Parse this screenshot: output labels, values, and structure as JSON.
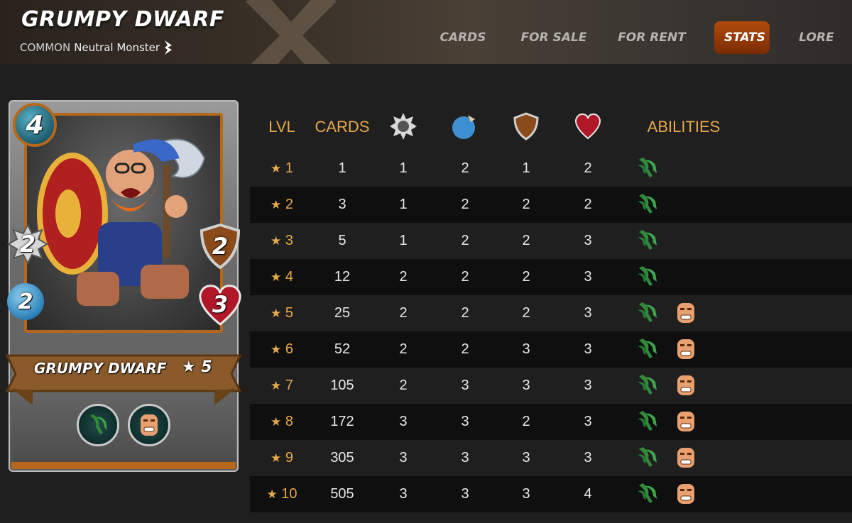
{
  "header": {
    "title": "GRUMPY DWARF",
    "rarity": "COMMON",
    "subtitle": "Neutral Monster",
    "tabs": [
      {
        "label": "CARDS",
        "active": false
      },
      {
        "label": "FOR SALE",
        "active": false
      },
      {
        "label": "FOR RENT",
        "active": false
      },
      {
        "label": "STATS",
        "active": true
      },
      {
        "label": "LORE",
        "active": false
      }
    ],
    "accent_color": "#b04a0a"
  },
  "card": {
    "name": "GRUMPY DWARF",
    "level": "★ 5",
    "mana": "4",
    "melee": "2",
    "speed": "2",
    "armor": "2",
    "health": "3",
    "abilities": [
      "reach-claw-icon",
      "enrage-face-icon"
    ]
  },
  "table": {
    "headers": {
      "lvl": "LVL",
      "cards": "CARDS",
      "melee_icon": "melee-icon",
      "speed_icon": "speed-icon",
      "armor_icon": "armor-icon",
      "health_icon": "health-icon",
      "abilities": "ABILITIES"
    },
    "rows": [
      {
        "star": "★",
        "lvl": "1",
        "cards": "1",
        "melee": "1",
        "speed": "2",
        "armor": "1",
        "health": "2",
        "abilities": [
          "claw"
        ]
      },
      {
        "star": "★",
        "lvl": "2",
        "cards": "3",
        "melee": "1",
        "speed": "2",
        "armor": "2",
        "health": "2",
        "abilities": [
          "claw"
        ]
      },
      {
        "star": "★",
        "lvl": "3",
        "cards": "5",
        "melee": "1",
        "speed": "2",
        "armor": "2",
        "health": "3",
        "abilities": [
          "claw"
        ]
      },
      {
        "star": "★",
        "lvl": "4",
        "cards": "12",
        "melee": "2",
        "speed": "2",
        "armor": "2",
        "health": "3",
        "abilities": [
          "claw"
        ]
      },
      {
        "star": "★",
        "lvl": "5",
        "cards": "25",
        "melee": "2",
        "speed": "2",
        "armor": "2",
        "health": "3",
        "abilities": [
          "claw",
          "face"
        ]
      },
      {
        "star": "★",
        "lvl": "6",
        "cards": "52",
        "melee": "2",
        "speed": "2",
        "armor": "3",
        "health": "3",
        "abilities": [
          "claw",
          "face"
        ]
      },
      {
        "star": "★",
        "lvl": "7",
        "cards": "105",
        "melee": "2",
        "speed": "3",
        "armor": "3",
        "health": "3",
        "abilities": [
          "claw",
          "face"
        ]
      },
      {
        "star": "★",
        "lvl": "8",
        "cards": "172",
        "melee": "3",
        "speed": "3",
        "armor": "2",
        "health": "3",
        "abilities": [
          "claw",
          "face"
        ]
      },
      {
        "star": "★",
        "lvl": "9",
        "cards": "305",
        "melee": "3",
        "speed": "3",
        "armor": "3",
        "health": "3",
        "abilities": [
          "claw",
          "face"
        ]
      },
      {
        "star": "★",
        "lvl": "10",
        "cards": "505",
        "melee": "3",
        "speed": "3",
        "armor": "3",
        "health": "4",
        "abilities": [
          "claw",
          "face"
        ]
      }
    ]
  }
}
